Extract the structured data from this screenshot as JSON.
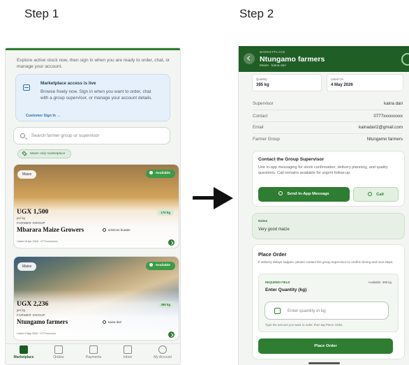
{
  "steps": {
    "step1": "Step 1",
    "step2": "Step 2"
  },
  "screen1": {
    "intro": "Explore active stock now, then sign in when you are ready to order, chat, or manage your account.",
    "notice": {
      "title": "Marketplace access is live",
      "body": "Browse freely now. Sign in when you want to order, chat with a group supervisor, or manage your account details.",
      "link": "Customer Sign In  →"
    },
    "search_placeholder": "Search farmer group or supervisor",
    "filter_chip": "Maize only marketplace",
    "listings": [
      {
        "category": "Maize",
        "status": "Available",
        "price": "UGX 1,500",
        "unit": "per kg",
        "quantity": "170 kg",
        "group_label": "FARMER GROUP",
        "group_name": "Mbarara Maize Growers",
        "supervisor": "solomon buwule",
        "meta": "Listed 18 Apr 2026 · 0777xxxxxxxxx"
      },
      {
        "category": "Maize",
        "status": "Available",
        "price": "UGX 2,236",
        "unit": "per kg",
        "quantity": "395 kg",
        "group_label": "FARMER GROUP",
        "group_name": "Ntungamo farmers",
        "supervisor": "kaina dari",
        "meta": "Listed 4 May 2026 · 0777xxxxxxxx"
      }
    ],
    "tabs": [
      {
        "label": "Marketplace",
        "icon": "store-icon",
        "active": true
      },
      {
        "label": "Orders",
        "icon": "orders-icon"
      },
      {
        "label": "Payments",
        "icon": "payments-icon"
      },
      {
        "label": "Inbox",
        "icon": "inbox-icon"
      },
      {
        "label": "My Account",
        "icon": "account-icon"
      }
    ]
  },
  "screen2": {
    "overline": "MARKETPLACE",
    "title": "Ntungamo farmers",
    "subtitle": "Maize · kaina dari",
    "quantity_label": "Quantity",
    "quantity_value": "395 kg",
    "listed_label": "Listed On",
    "listed_value": "4 May 2026",
    "details": [
      {
        "label": "Supervisor",
        "value": "kaina dari"
      },
      {
        "label": "Contact",
        "value": "0777xxxxxxxxx"
      },
      {
        "label": "Email",
        "value": "kainadari2@gmail.com"
      },
      {
        "label": "Farmer Group",
        "value": "Ntungamo farmers"
      }
    ],
    "contact": {
      "title": "Contact the Group Supervisor",
      "body": "Use in-app messaging for stock confirmation, delivery planning, and quality questions. Call remains available for urgent follow-up.",
      "message_button": "Send In-App Message",
      "call_button": "Call"
    },
    "notes": {
      "label": "Notes",
      "value": "Very good maize"
    },
    "order": {
      "title": "Place Order",
      "hint": "If delivery delays happen, please contact the group supervisor to confirm timing and next steps.",
      "required_label": "REQUIRED FIELD",
      "available": "Available: 395 kg",
      "field_label": "Enter Quantity (kg)",
      "placeholder": "Enter quantity in kg",
      "field_hint": "Type the amount you want to order, then tap Place Order.",
      "submit": "Place Order"
    }
  },
  "colors": {
    "brand_green": "#2e7d32",
    "header_green": "#1f5e25",
    "available_green": "#3d9b48",
    "info_blue": "#2a6fb0"
  }
}
